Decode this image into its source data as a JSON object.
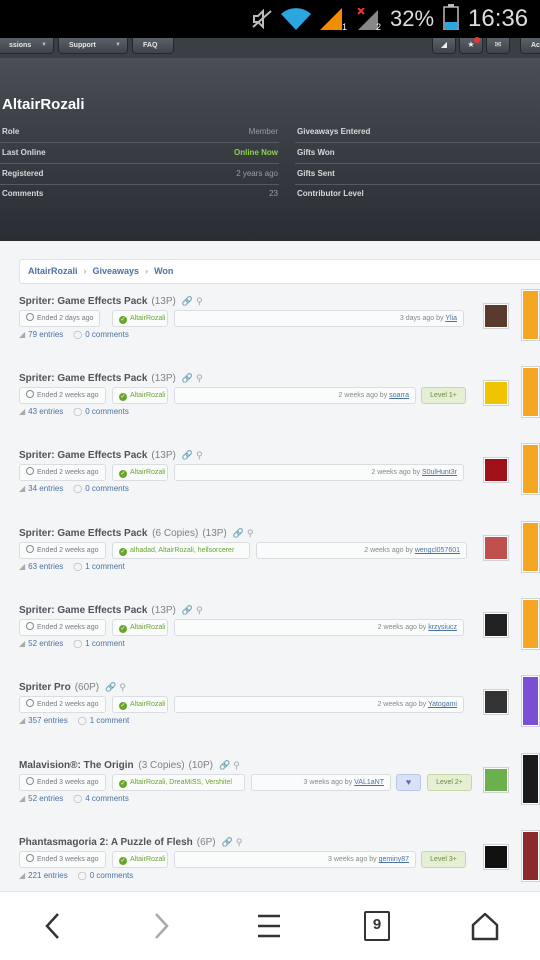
{
  "status_bar": {
    "battery_percent": "32%",
    "time": "16:36",
    "icons": [
      "mute-icon",
      "wifi-icon",
      "signal-1-icon",
      "signal-2-icon",
      "battery-icon"
    ],
    "sim1_label": "1",
    "sim2_label": "2"
  },
  "top_nav": {
    "items": [
      {
        "label": "ssions"
      },
      {
        "label": "Support"
      },
      {
        "label": "FAQ"
      }
    ],
    "right_icons": [
      "gift-icon",
      "trophy-icon",
      "mail-icon"
    ],
    "cut_label": "Ac"
  },
  "profile": {
    "username": "AltairRozali",
    "left_rows": [
      {
        "label": "Role",
        "value": "Member"
      },
      {
        "label": "Last Online",
        "value": "Online Now"
      },
      {
        "label": "Registered",
        "value": "2 years ago"
      },
      {
        "label": "Comments",
        "value": "23"
      }
    ],
    "right_rows": [
      {
        "label": "Giveaways Entered"
      },
      {
        "label": "Gifts Won"
      },
      {
        "label": "Gifts Sent"
      },
      {
        "label": "Contributor Level"
      }
    ]
  },
  "breadcrumb": [
    "AltairRozali",
    "Giveaways",
    "Won"
  ],
  "giveaways": [
    {
      "title": "Spriter: Game Effects Pack",
      "copies": "",
      "points": "(13P)",
      "ended": "Ended 2 days ago",
      "winners": "AltairRozali",
      "created": "3 days ago by",
      "creator": "Ylia",
      "level": "",
      "heart": false,
      "entries": "79 entries",
      "comments": "0 comments",
      "avatar_color": "#5a3a2a",
      "thumb_color": "#f5a623"
    },
    {
      "title": "Spriter: Game Effects Pack",
      "copies": "",
      "points": "(13P)",
      "ended": "Ended 2 weeks ago",
      "winners": "AltairRozali",
      "created": "2 weeks ago by",
      "creator": "soarra",
      "level": "Level 1+",
      "heart": false,
      "entries": "43 entries",
      "comments": "0 comments",
      "avatar_color": "#f0c400",
      "thumb_color": "#f5a623"
    },
    {
      "title": "Spriter: Game Effects Pack",
      "copies": "",
      "points": "(13P)",
      "ended": "Ended 2 weeks ago",
      "winners": "AltairRozali",
      "created": "2 weeks ago by",
      "creator": "S0ulHunt3r",
      "level": "",
      "heart": false,
      "entries": "34 entries",
      "comments": "0 comments",
      "avatar_color": "#a01018",
      "thumb_color": "#f5a623"
    },
    {
      "title": "Spriter: Game Effects Pack",
      "copies": "(6 Copies)",
      "points": "(13P)",
      "ended": "Ended 2 weeks ago",
      "winners": "alhadad, AltairRozali, hellsorcerer",
      "created": "2 weeks ago by",
      "creator": "wengcl057601",
      "level": "",
      "heart": false,
      "entries": "63 entries",
      "comments": "1 comment",
      "avatar_color": "#c0504d",
      "thumb_color": "#f5a623"
    },
    {
      "title": "Spriter: Game Effects Pack",
      "copies": "",
      "points": "(13P)",
      "ended": "Ended 2 weeks ago",
      "winners": "AltairRozali",
      "created": "2 weeks ago by",
      "creator": "krzysiucz",
      "level": "",
      "heart": false,
      "entries": "52 entries",
      "comments": "1 comment",
      "avatar_color": "#222222",
      "thumb_color": "#f5a623"
    },
    {
      "title": "Spriter Pro",
      "copies": "",
      "points": "(60P)",
      "ended": "Ended 2 weeks ago",
      "winners": "AltairRozali",
      "created": "2 weeks ago by",
      "creator": "Yatogami",
      "level": "",
      "heart": false,
      "entries": "357 entries",
      "comments": "1 comment",
      "avatar_color": "#333333",
      "thumb_color": "#7a4fd1"
    },
    {
      "title": "Malavision®: The Origin",
      "copies": "(3 Copies)",
      "points": "(10P)",
      "ended": "Ended 3 weeks ago",
      "winners": "AltairRozali, DreaMiSS, Vershitel",
      "created": "3 weeks ago by",
      "creator": "VAL1aNT",
      "level": "Level 2+",
      "heart": true,
      "entries": "52 entries",
      "comments": "4 comments",
      "avatar_color": "#6ab04c",
      "thumb_color": "#1a1a1a"
    },
    {
      "title": "Phantasmagoria 2: A Puzzle of Flesh",
      "copies": "",
      "points": "(6P)",
      "ended": "Ended 3 weeks ago",
      "winners": "AltairRozali",
      "created": "3 weeks ago by",
      "creator": "geminy87",
      "level": "Level 3+",
      "heart": false,
      "entries": "221 entries",
      "comments": "0 comments",
      "avatar_color": "#111111",
      "thumb_color": "#8a2a2a"
    }
  ],
  "nav_bar": {
    "tab_count": "9",
    "icons": [
      "back-icon",
      "forward-icon",
      "menu-icon",
      "tabs-icon",
      "home-icon"
    ]
  }
}
